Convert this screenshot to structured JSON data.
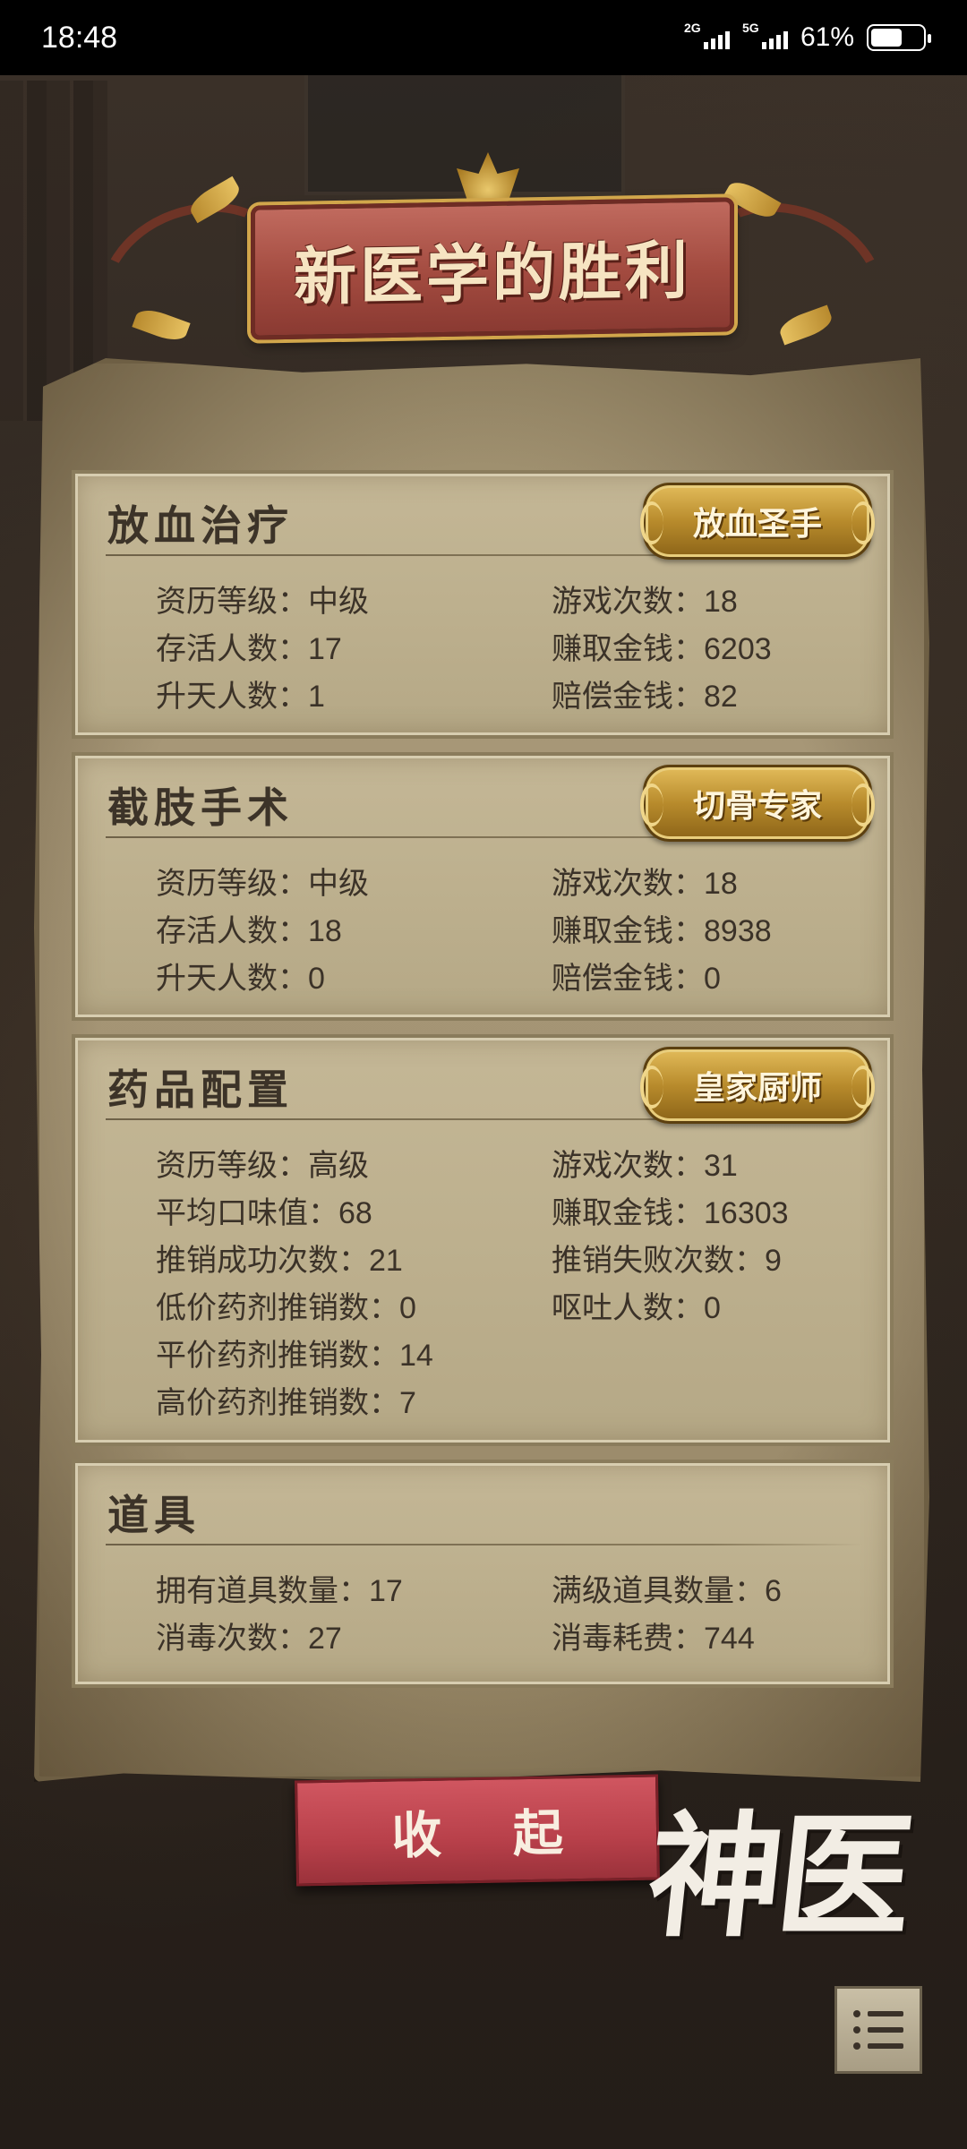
{
  "status_bar": {
    "time": "18:48",
    "network_1": "2G",
    "network_2": "5G",
    "battery": "61%",
    "battery_level": 0.61
  },
  "title": "新医学的胜利",
  "sections": [
    {
      "title": "放血治疗",
      "badge": "放血圣手",
      "left": [
        "资历等级：中级",
        "存活人数：17",
        "升天人数：1"
      ],
      "right": [
        "游戏次数：18",
        "赚取金钱：6203",
        "赔偿金钱：82"
      ]
    },
    {
      "title": "截肢手术",
      "badge": "切骨专家",
      "left": [
        "资历等级：中级",
        "存活人数：18",
        "升天人数：0"
      ],
      "right": [
        "游戏次数：18",
        "赚取金钱：8938",
        "赔偿金钱：0"
      ]
    },
    {
      "title": "药品配置",
      "badge": "皇家厨师",
      "left": [
        "资历等级：高级",
        "平均口味值：68",
        "推销成功次数：21",
        "低价药剂推销数：0",
        "平价药剂推销数：14",
        "高价药剂推销数：7"
      ],
      "right": [
        "游戏次数：31",
        "赚取金钱：16303",
        "推销失败次数：9",
        "呕吐人数：0"
      ]
    },
    {
      "title": "道具",
      "left": [
        "拥有道具数量：17",
        "消毒次数：27"
      ],
      "right": [
        "满级道具数量：6",
        "消毒耗费：744"
      ]
    }
  ],
  "collapse_button": "收 起",
  "logo_text": "神医",
  "menu_icon": "list-menu-icon"
}
